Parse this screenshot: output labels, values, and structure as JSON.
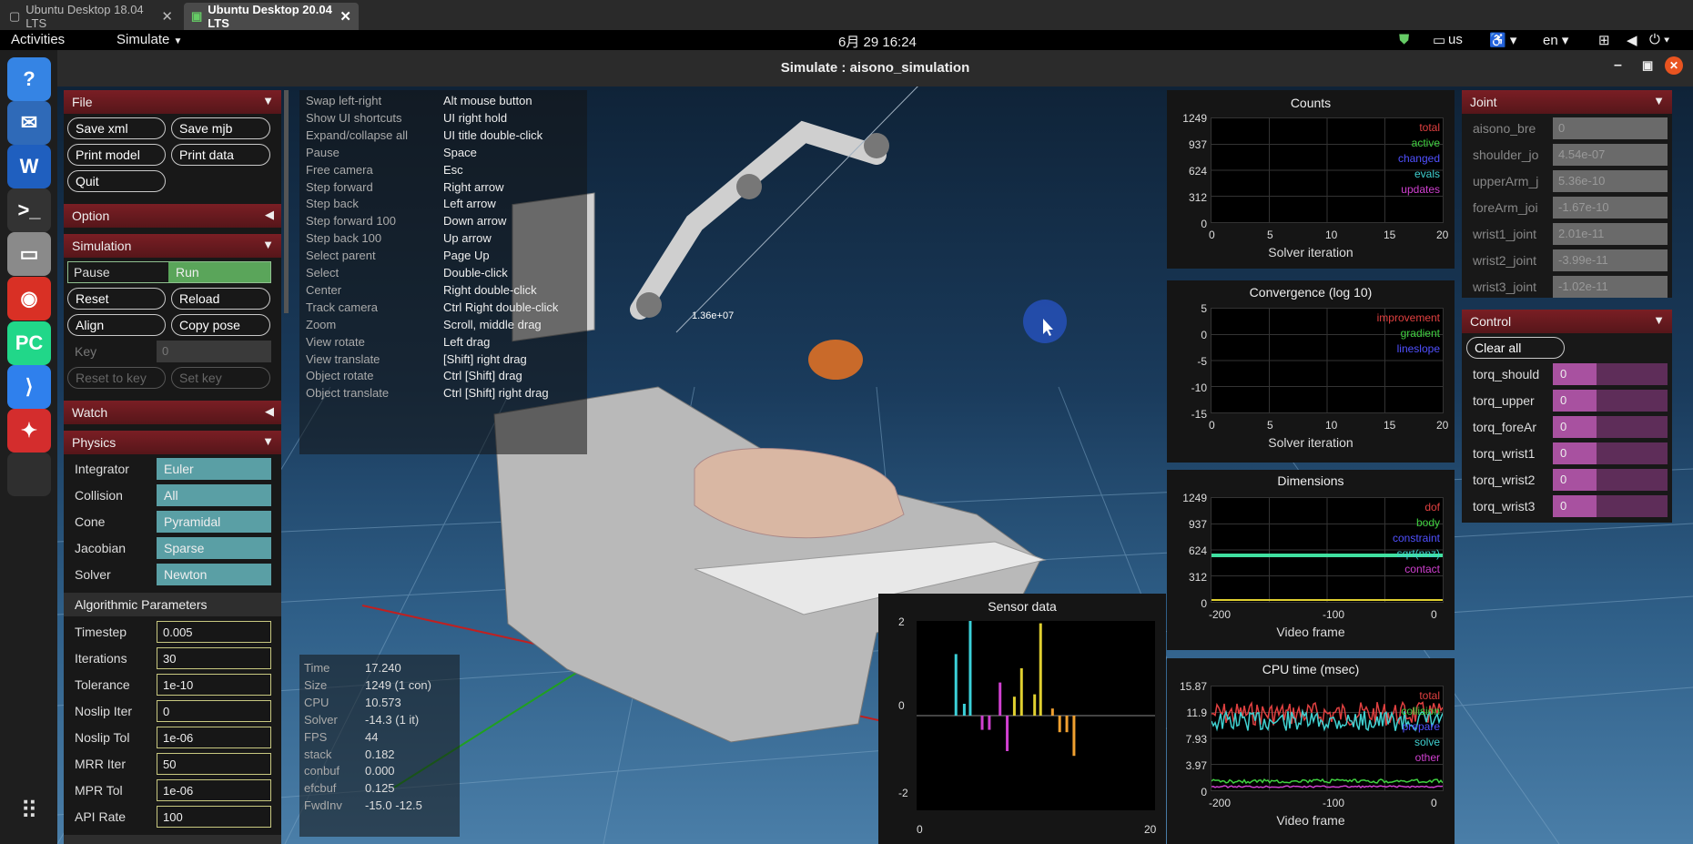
{
  "browser_tabs": [
    {
      "label": "Ubuntu Desktop 18.04 LTS",
      "active": false
    },
    {
      "label": "Ubuntu Desktop 20.04 LTS",
      "active": true
    }
  ],
  "topbar": {
    "activities": "Activities",
    "app_menu": "Simulate",
    "clock": "6月 29  16:24",
    "keyboard": "us",
    "language": "en"
  },
  "dock": [
    {
      "name": "help-icon",
      "glyph": "?",
      "color": "#3584e4"
    },
    {
      "name": "mail-icon",
      "glyph": "✉",
      "color": "#2f6ab8"
    },
    {
      "name": "wps-icon",
      "glyph": "W",
      "color": "#1f5fbf"
    },
    {
      "name": "terminal-icon",
      "glyph": ">_",
      "color": "#333333"
    },
    {
      "name": "files-icon",
      "glyph": "▭",
      "color": "#8a8a8a"
    },
    {
      "name": "chrome-icon",
      "glyph": "◉",
      "color": "#d93025"
    },
    {
      "name": "pycharm-icon",
      "glyph": "PC",
      "color": "#21d789"
    },
    {
      "name": "vscode-icon",
      "glyph": "⟩",
      "color": "#2f80ed"
    },
    {
      "name": "app-icon",
      "glyph": "✦",
      "color": "#d42d2d"
    },
    {
      "name": "active-app-icon",
      "glyph": "",
      "color": "#2f2f2f"
    }
  ],
  "window_title": "Simulate : aisono_simulation",
  "file": {
    "title": "File",
    "buttons": [
      "Save xml",
      "Save mjb",
      "Print model",
      "Print data",
      "Quit"
    ]
  },
  "option": {
    "title": "Option"
  },
  "simulation": {
    "title": "Simulation",
    "pause": "Pause",
    "run": "Run",
    "reset": "Reset",
    "reload": "Reload",
    "align": "Align",
    "copy_pose": "Copy pose",
    "key_label": "Key",
    "key_value": "0",
    "reset_to_key": "Reset to key",
    "set_key": "Set key"
  },
  "watch": {
    "title": "Watch"
  },
  "physics": {
    "title": "Physics",
    "selects": [
      {
        "label": "Integrator",
        "value": "Euler"
      },
      {
        "label": "Collision",
        "value": "All"
      },
      {
        "label": "Cone",
        "value": "Pyramidal"
      },
      {
        "label": "Jacobian",
        "value": "Sparse"
      },
      {
        "label": "Solver",
        "value": "Newton"
      }
    ],
    "algo_title": "Algorithmic Parameters",
    "params": [
      {
        "label": "Timestep",
        "value": "0.005"
      },
      {
        "label": "Iterations",
        "value": "30"
      },
      {
        "label": "Tolerance",
        "value": "1e-10"
      },
      {
        "label": "Noslip Iter",
        "value": "0"
      },
      {
        "label": "Noslip Tol",
        "value": "1e-06"
      },
      {
        "label": "MRR Iter",
        "value": "50"
      },
      {
        "label": "MPR Tol",
        "value": "1e-06"
      },
      {
        "label": "API Rate",
        "value": "100"
      }
    ]
  },
  "shortcuts": [
    [
      "Swap left-right",
      "Alt mouse button"
    ],
    [
      "Show UI shortcuts",
      "UI right hold"
    ],
    [
      "Expand/collapse all",
      "UI title double-click"
    ],
    [
      "Pause",
      "Space"
    ],
    [
      "Free camera",
      "Esc"
    ],
    [
      "Step forward",
      "Right arrow"
    ],
    [
      "Step back",
      "Left arrow"
    ],
    [
      "Step forward 100",
      "Down arrow"
    ],
    [
      "Step back 100",
      "Up arrow"
    ],
    [
      "Select parent",
      "Page Up"
    ],
    [
      "Select",
      "Double-click"
    ],
    [
      "Center",
      "Right double-click"
    ],
    [
      "Track camera",
      "Ctrl Right double-click"
    ],
    [
      "Zoom",
      "Scroll, middle drag"
    ],
    [
      "View rotate",
      "Left drag"
    ],
    [
      "View translate",
      "[Shift] right drag"
    ],
    [
      "Object rotate",
      "Ctrl [Shift] drag"
    ],
    [
      "Object translate",
      "Ctrl [Shift] right drag"
    ]
  ],
  "scene_label": "1.36e+07",
  "info": [
    [
      "Time",
      "17.240"
    ],
    [
      "Size",
      "1249  (1 con)"
    ],
    [
      "CPU",
      "10.573"
    ],
    [
      "Solver",
      "-14.3  (1 it)"
    ],
    [
      "FPS",
      "44"
    ],
    [
      "stack",
      "0.182"
    ],
    [
      "conbuf",
      "0.000"
    ],
    [
      "efcbuf",
      "0.125"
    ],
    [
      "FwdInv",
      "-15.0 -12.5"
    ]
  ],
  "counts": {
    "title": "Counts",
    "yticks": [
      "1249",
      "937",
      "624",
      "312",
      "0"
    ],
    "xticks": [
      "0",
      "5",
      "10",
      "15",
      "20"
    ],
    "xlabel": "Solver iteration",
    "legend": [
      [
        "total",
        "#e04040"
      ],
      [
        "active",
        "#40d040"
      ],
      [
        "changed",
        "#5050ff"
      ],
      [
        "evals",
        "#40d0d0"
      ],
      [
        "updates",
        "#d040d0"
      ]
    ]
  },
  "convergence": {
    "title": "Convergence (log 10)",
    "yticks": [
      "5",
      "0",
      "-5",
      "-10",
      "-15"
    ],
    "xticks": [
      "0",
      "5",
      "10",
      "15",
      "20"
    ],
    "xlabel": "Solver iteration",
    "legend": [
      [
        "improvement",
        "#e04040"
      ],
      [
        "gradient",
        "#40d040"
      ],
      [
        "lineslope",
        "#5050ff"
      ]
    ]
  },
  "dimensions": {
    "title": "Dimensions",
    "yticks": [
      "1249",
      "937",
      "624",
      "312",
      "0"
    ],
    "xticks": [
      "-200",
      "-100",
      "0"
    ],
    "xlabel": "Video frame",
    "legend": [
      [
        "dof",
        "#e04040"
      ],
      [
        "body",
        "#40d040"
      ],
      [
        "constraint",
        "#5050ff"
      ],
      [
        "sqrt(nnz)",
        "#40d0d0"
      ],
      [
        "contact",
        "#d040d0"
      ]
    ]
  },
  "cputime": {
    "title": "CPU time (msec)",
    "yticks": [
      "15.87",
      "11.9",
      "7.93",
      "3.97",
      "0"
    ],
    "xticks": [
      "-200",
      "-100",
      "0"
    ],
    "xlabel": "Video frame",
    "legend": [
      [
        "total",
        "#e04040"
      ],
      [
        "collision",
        "#40d040"
      ],
      [
        "prepare",
        "#5050ff"
      ],
      [
        "solve",
        "#40d0d0"
      ],
      [
        "other",
        "#d040d0"
      ]
    ]
  },
  "sensor": {
    "title": "Sensor data",
    "yticks": [
      "2",
      "0",
      "-2"
    ],
    "xticks": [
      "0",
      "20"
    ]
  },
  "joint": {
    "title": "Joint",
    "items": [
      {
        "label": "aisono_bre",
        "value": "0"
      },
      {
        "label": "shoulder_jo",
        "value": "4.54e-07"
      },
      {
        "label": "upperArm_j",
        "value": "5.36e-10"
      },
      {
        "label": "foreArm_joi",
        "value": "-1.67e-10"
      },
      {
        "label": "wrist1_joint",
        "value": "2.01e-11"
      },
      {
        "label": "wrist2_joint",
        "value": "-3.99e-11"
      },
      {
        "label": "wrist3_joint",
        "value": "-1.02e-11"
      }
    ]
  },
  "control": {
    "title": "Control",
    "clear_all": "Clear all",
    "items": [
      {
        "label": "torq_should",
        "value": "0"
      },
      {
        "label": "torq_upper",
        "value": "0"
      },
      {
        "label": "torq_foreAr",
        "value": "0"
      },
      {
        "label": "torq_wrist1",
        "value": "0"
      },
      {
        "label": "torq_wrist2",
        "value": "0"
      },
      {
        "label": "torq_wrist3",
        "value": "0"
      }
    ]
  },
  "chart_data": {
    "type": "bar",
    "title": "Sensor data",
    "xlim": [
      0,
      20
    ],
    "ylim": [
      -2,
      2
    ],
    "series": [
      {
        "values": [
          {
            "x": 3.3,
            "y": 1.3
          },
          {
            "x": 4.0,
            "y": 0.25
          },
          {
            "x": 4.5,
            "y": 2.0
          },
          {
            "x": 5.5,
            "y": -0.3
          },
          {
            "x": 6.1,
            "y": -0.3
          },
          {
            "x": 7.0,
            "y": 0.7
          },
          {
            "x": 7.6,
            "y": -0.75
          },
          {
            "x": 8.2,
            "y": 0.4
          },
          {
            "x": 8.8,
            "y": 1.0
          },
          {
            "x": 9.9,
            "y": 0.45
          },
          {
            "x": 10.4,
            "y": 1.95
          },
          {
            "x": 11.4,
            "y": 0.15
          },
          {
            "x": 12.0,
            "y": -0.35
          },
          {
            "x": 12.6,
            "y": -0.35
          },
          {
            "x": 13.2,
            "y": -0.85
          }
        ]
      }
    ],
    "bar_colors": [
      "#3bd0d8",
      "#3bd0d8",
      "#3bd0d8",
      "#d040d0",
      "#d040d0",
      "#d040d0",
      "#d040d0",
      "#e0d030",
      "#e0d030",
      "#e0d030",
      "#e0d030",
      "#f0a030",
      "#f0a030",
      "#f0a030",
      "#f0a030"
    ]
  }
}
